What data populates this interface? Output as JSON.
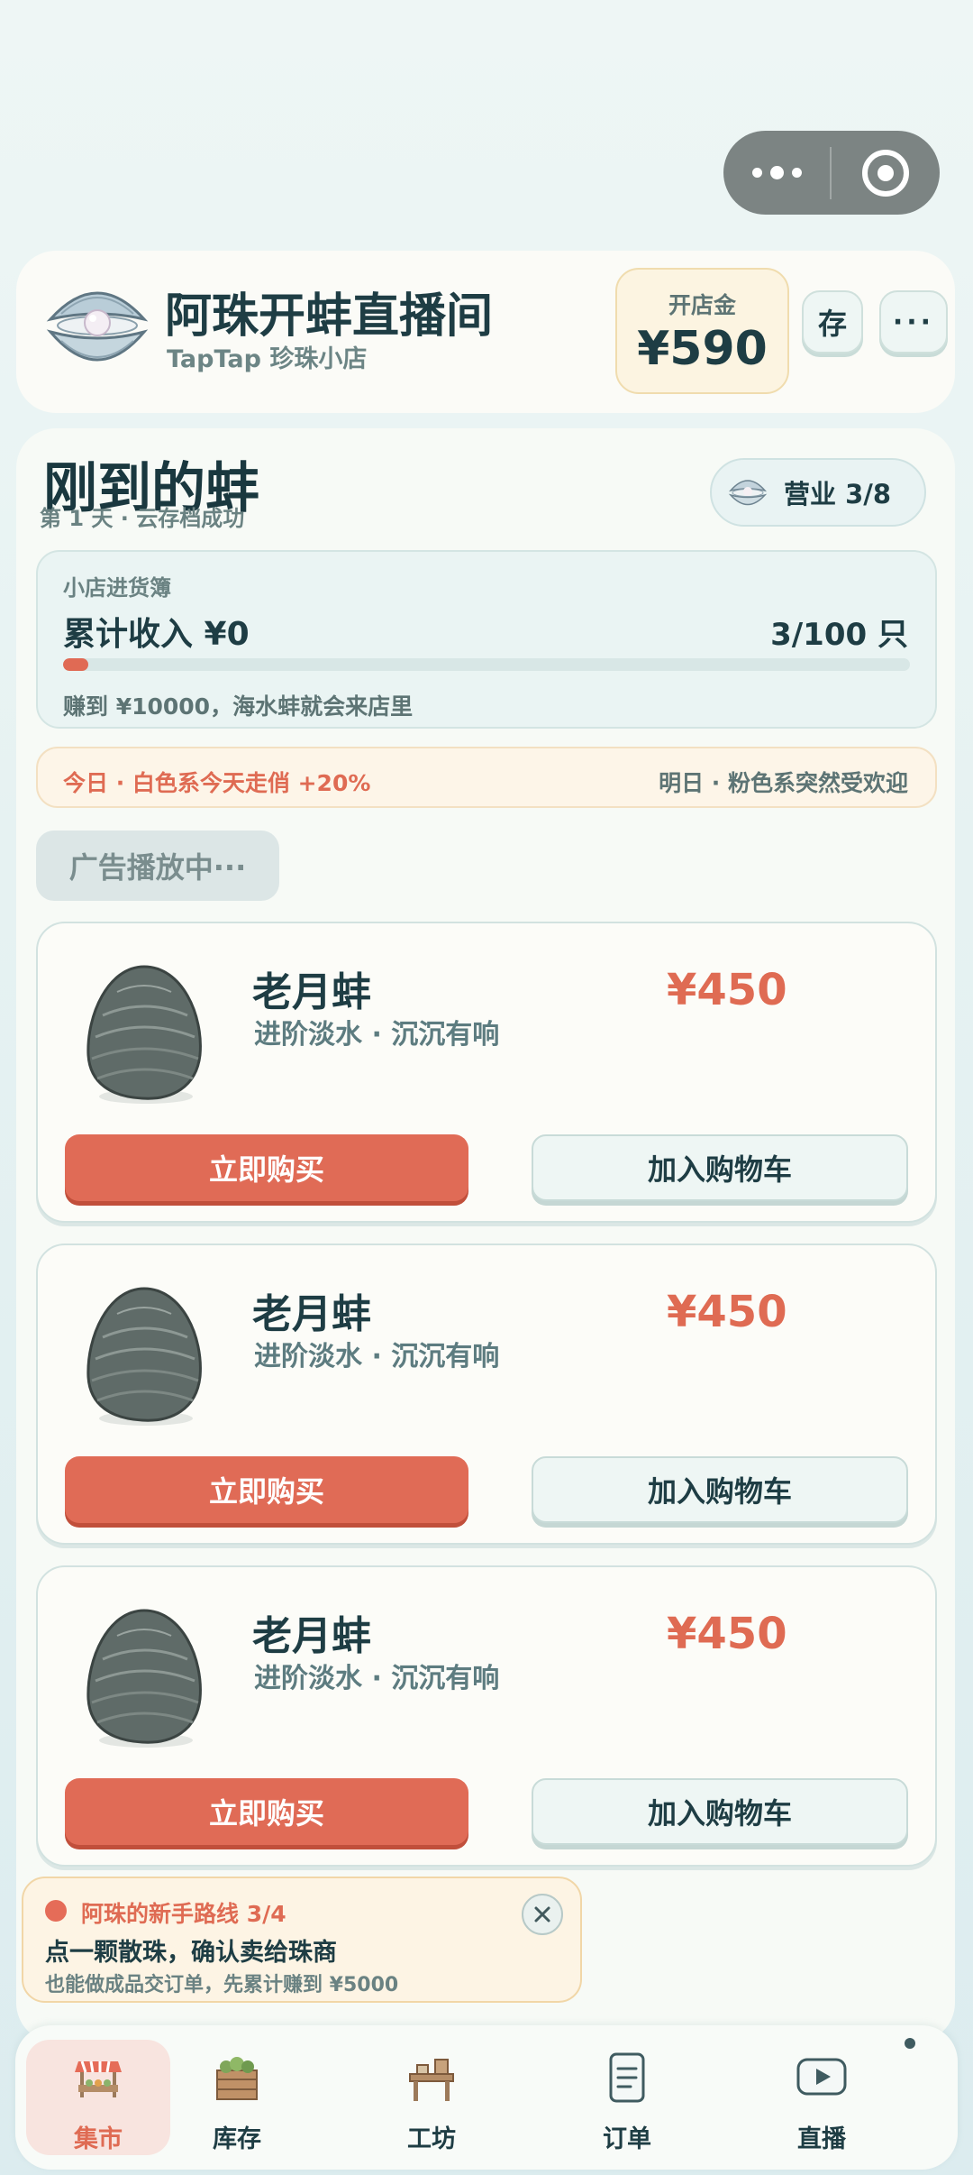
{
  "header": {
    "store_title": "阿珠开蚌直播间",
    "store_subtitle": "TapTap 珍珠小店",
    "fund_label": "开店金",
    "fund_value": "¥590",
    "save_label": "存",
    "more_label": "···"
  },
  "main": {
    "title": "刚到的蚌",
    "subtitle": "第 1 天 · 云存档成功",
    "business_label": "营业 3/8",
    "ledger": {
      "title": "小店进货簿",
      "income_label": "累计收入 ¥0",
      "count_label": "3/100 只",
      "progress": 0.03,
      "hint": "赚到 ¥10000，海水蚌就会来店里"
    },
    "trend": {
      "today": "今日 · 白色系今天走俏 +20%",
      "tomorrow": "明日 · 粉色系突然受欢迎"
    },
    "ad_label": "广告播放中···",
    "products": [
      {
        "name": "老月蚌",
        "desc": "进阶淡水 · 沉沉有响",
        "price": "¥450",
        "buy_label": "立即购买",
        "cart_label": "加入购物车"
      },
      {
        "name": "老月蚌",
        "desc": "进阶淡水 · 沉沉有响",
        "price": "¥450",
        "buy_label": "立即购买",
        "cart_label": "加入购物车"
      },
      {
        "name": "老月蚌",
        "desc": "进阶淡水 · 沉沉有响",
        "price": "¥450",
        "buy_label": "立即购买",
        "cart_label": "加入购物车"
      }
    ]
  },
  "guide": {
    "title": "阿珠的新手路线 3/4",
    "main": "点一颗散珠，确认卖给珠商",
    "sub": "也能做成品交订单，先累计赚到 ¥5000"
  },
  "tabs": [
    {
      "label": "集市",
      "icon": "market-stall-icon",
      "active": true
    },
    {
      "label": "库存",
      "icon": "crate-icon",
      "active": false
    },
    {
      "label": "工坊",
      "icon": "workbench-icon",
      "active": false
    },
    {
      "label": "订单",
      "icon": "document-icon",
      "active": false
    },
    {
      "label": "直播",
      "icon": "live-video-icon",
      "active": false
    }
  ],
  "colors": {
    "accent": "#df6b53",
    "primary_text": "#1e3d44",
    "muted_text": "#5d7474"
  }
}
